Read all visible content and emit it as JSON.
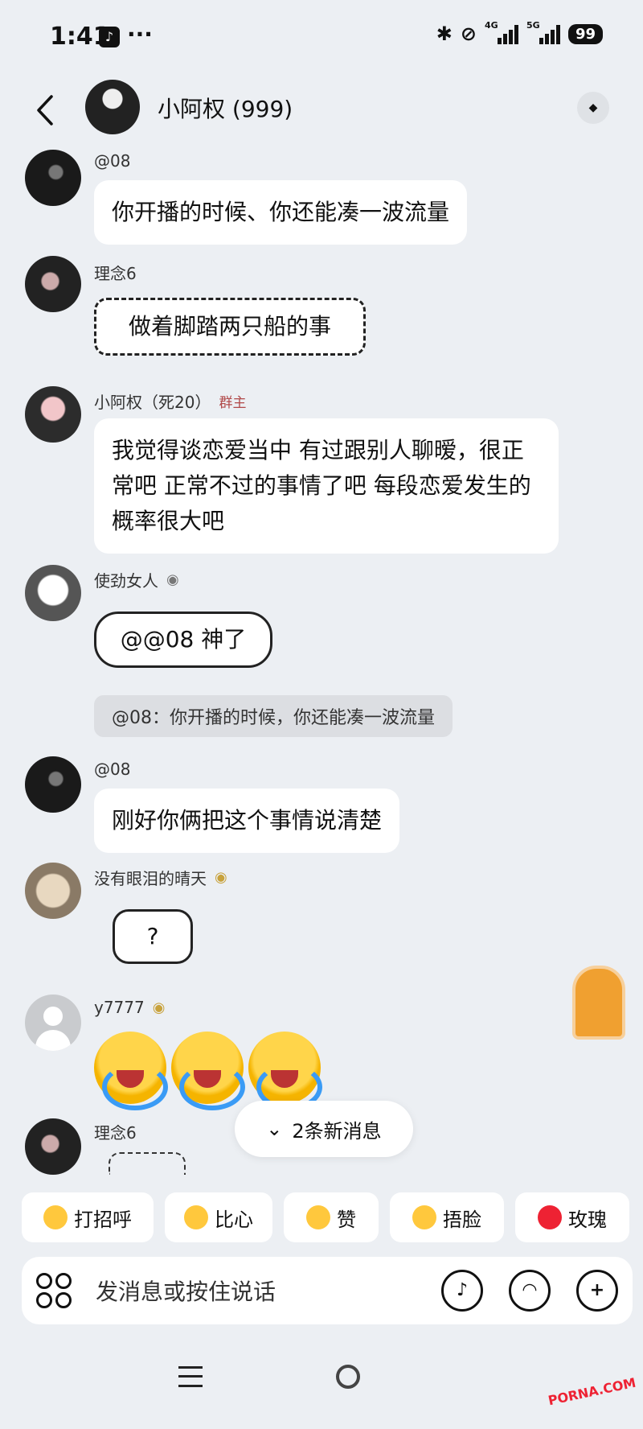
{
  "status_bar": {
    "time": "1:41",
    "app_icon": "tiktok-icon",
    "dots": "···",
    "net1": "4G",
    "net2": "5G",
    "battery": "99"
  },
  "header": {
    "title": "小阿权 (999)",
    "back_icon": "back-icon",
    "more_icon": "more-icon"
  },
  "messages": [
    {
      "sender": "@08",
      "text": "你开播的时候、你还能凑一波流量"
    },
    {
      "sender": "理念6",
      "sticker_text": "做着脚踏两只船的事"
    },
    {
      "sender": "小阿权（死20）",
      "tag": "群主",
      "text": "我觉得谈恋爱当中 有过跟别人聊暧，很正常吧 正常不过的事情了吧 每段恋爱发生的概率很大吧"
    },
    {
      "sender": "使劲女人",
      "sticker_text": "@@08 神了",
      "quote": "@08：你开播的时候，你还能凑一波流量"
    },
    {
      "sender": "@08",
      "text": "刚好你俩把这个事情说清楚"
    },
    {
      "sender": "没有眼泪的晴天",
      "sticker_text": "?"
    },
    {
      "sender": "y7777",
      "emoji": [
        "loudly-crying-face",
        "loudly-crying-face",
        "loudly-crying-face"
      ]
    },
    {
      "sender": "理念6"
    }
  ],
  "new_messages": {
    "icon": "double-chevron-down-icon",
    "label": "2条新消息"
  },
  "quick_replies": [
    {
      "label": "打招呼",
      "icon": "greet-emoji-icon"
    },
    {
      "label": "比心",
      "icon": "heart-hands-emoji-icon"
    },
    {
      "label": "赞",
      "icon": "thumbs-up-icon"
    },
    {
      "label": "捂脸",
      "icon": "facepalm-emoji-icon"
    },
    {
      "label": "玫瑰",
      "icon": "rose-icon"
    }
  ],
  "input": {
    "placeholder": "发消息或按住说话"
  },
  "watermark": "PORNA.COM"
}
